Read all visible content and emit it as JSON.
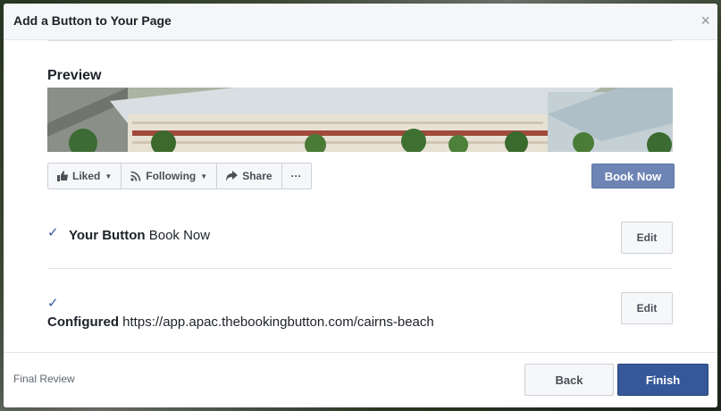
{
  "dialog": {
    "title": "Add a Button to Your Page",
    "close_glyph": "×"
  },
  "preview": {
    "title": "Preview",
    "actions": [
      {
        "label": "Liked",
        "icon": "like-icon",
        "has_caret": true
      },
      {
        "label": "Following",
        "icon": "rss-icon",
        "has_caret": true
      },
      {
        "label": "Share",
        "icon": "share-icon",
        "has_caret": false
      },
      {
        "label": "···",
        "icon": "more-icon",
        "has_caret": false
      }
    ],
    "cta_label": "Book Now"
  },
  "rows": {
    "button": {
      "label": "Your Button",
      "value": "Book Now",
      "edit": "Edit"
    },
    "configured": {
      "label": "Configured",
      "value": "https://app.apac.thebookingbutton.com/cairns-beach",
      "edit": "Edit"
    }
  },
  "footer": {
    "step": "Final Review",
    "back": "Back",
    "finish": "Finish"
  },
  "colors": {
    "primary": "#365899",
    "cta": "#6d84b4",
    "header_bg": "#f5f6f7"
  }
}
